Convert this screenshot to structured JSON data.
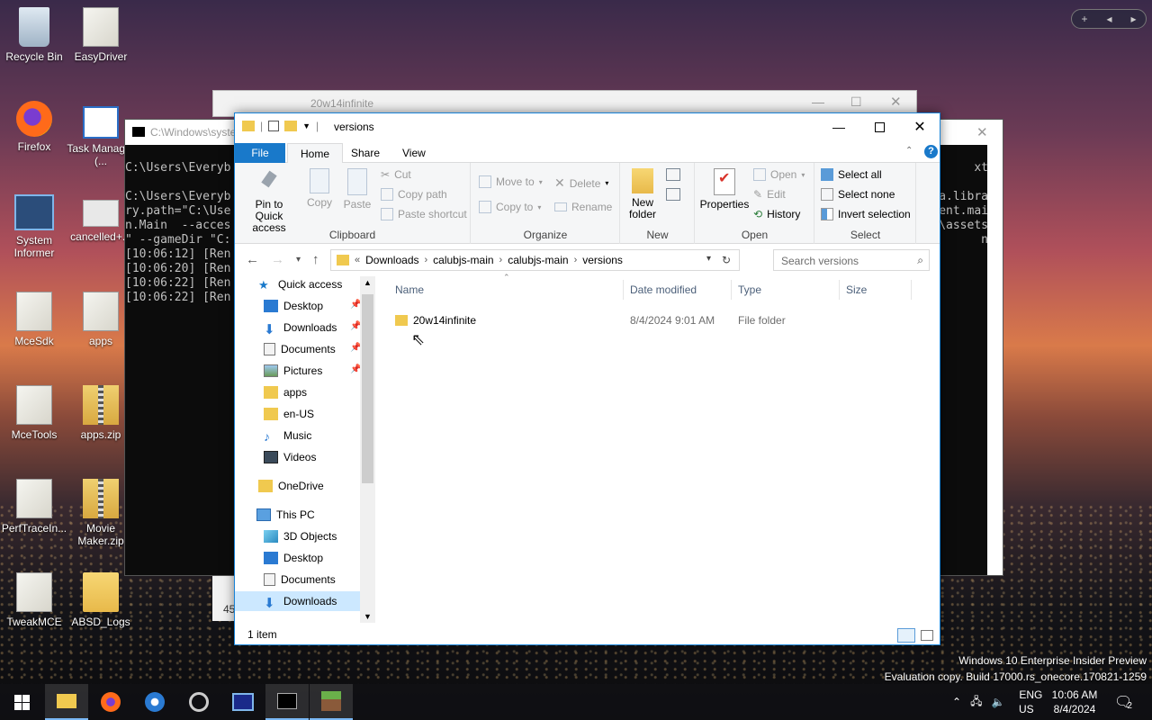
{
  "desktop": {
    "icons": [
      {
        "label": "Recycle Bin"
      },
      {
        "label": "EasyDriver"
      },
      {
        "label": "Firefox"
      },
      {
        "label": "Task Manager (..."
      },
      {
        "label": "System Informer"
      },
      {
        "label": "cancelled+..."
      },
      {
        "label": "MceSdk"
      },
      {
        "label": "apps"
      },
      {
        "label": "MceTools"
      },
      {
        "label": "apps.zip"
      },
      {
        "label": "PerfTraceIn..."
      },
      {
        "label": "Movie Maker.zip"
      },
      {
        "label": "TweakMCE"
      },
      {
        "label": "ABSD_Logs"
      }
    ]
  },
  "background_window": {
    "title": "20w14infinite"
  },
  "cmd_window": {
    "title": "C:\\Windows\\syste",
    "lines": [
      "C:\\Users\\Everyb",
      "",
      "C:\\Users\\Everyb",
      "ry.path=\"C:\\Use",
      "n.Main  --acces",
      "\" --gameDir \"C:",
      "[10:06:12] [Ren",
      "[10:06:20] [Ren",
      "[10:06:22] [Ren",
      "[10:06:22] [Ren"
    ],
    "right_lines": [
      "xt",
      "",
      "a.libra",
      "ent.mai",
      "\\assets",
      "n"
    ],
    "partial": "45"
  },
  "explorer": {
    "title": "versions",
    "menu": {
      "file": "File",
      "home": "Home",
      "share": "Share",
      "view": "View"
    },
    "ribbon": {
      "pin": "Pin to Quick access",
      "copy": "Copy",
      "paste": "Paste",
      "cut": "Cut",
      "copy_path": "Copy path",
      "paste_shortcut": "Paste shortcut",
      "clipboard": "Clipboard",
      "move_to": "Move to",
      "copy_to": "Copy to",
      "delete": "Delete",
      "rename": "Rename",
      "organize": "Organize",
      "new_folder": "New folder",
      "new": "New",
      "properties": "Properties",
      "open_btn": "Open",
      "edit": "Edit",
      "history": "History",
      "open_group": "Open",
      "select_all": "Select all",
      "select_none": "Select none",
      "invert_selection": "Invert selection",
      "select": "Select"
    },
    "address": {
      "prefix": "«",
      "crumbs": [
        "Downloads",
        "calubjs-main",
        "calubjs-main",
        "versions"
      ],
      "search_placeholder": "Search versions"
    },
    "nav": {
      "quick_access": "Quick access",
      "desktop": "Desktop",
      "downloads": "Downloads",
      "documents": "Documents",
      "pictures": "Pictures",
      "apps": "apps",
      "en_us": "en-US",
      "music": "Music",
      "videos": "Videos",
      "onedrive": "OneDrive",
      "this_pc": "This PC",
      "objects3d": "3D Objects",
      "desktop2": "Desktop",
      "documents2": "Documents",
      "downloads2": "Downloads"
    },
    "columns": {
      "name": "Name",
      "date": "Date modified",
      "type": "Type",
      "size": "Size"
    },
    "rows": [
      {
        "name": "20w14infinite",
        "date": "8/4/2024 9:01 AM",
        "type": "File folder",
        "size": ""
      }
    ],
    "status": "1 item"
  },
  "watermark": {
    "line1": "Windows 10 Enterprise Insider Preview",
    "line2": "Evaluation copy. Build 17000.rs_onecore.170821-1259"
  },
  "tray": {
    "lang1": "ENG",
    "lang2": "US",
    "time": "10:06 AM",
    "date": "8/4/2024",
    "notif_count": "2"
  },
  "colors": {
    "accent": "#1979ca",
    "folder": "#f0c94f"
  }
}
